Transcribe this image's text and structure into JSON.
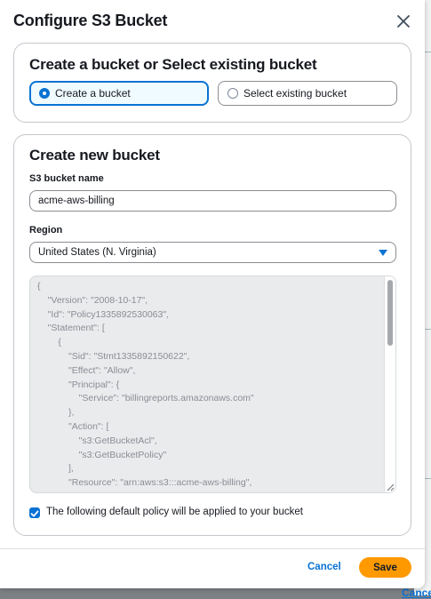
{
  "modal": {
    "title": "Configure S3 Bucket",
    "close_icon": "close-icon"
  },
  "bucket_choice": {
    "heading": "Create a bucket or Select existing bucket",
    "options": [
      {
        "label": "Create a bucket",
        "selected": true
      },
      {
        "label": "Select existing bucket",
        "selected": false
      }
    ]
  },
  "create_bucket": {
    "heading": "Create new bucket",
    "name_label": "S3 bucket name",
    "name_value": "acme-aws-billing",
    "region_label": "Region",
    "region_value": "United States (N. Virginia)",
    "region_icon": "caret-down-icon",
    "policy_text": "{\n    \"Version\": \"2008-10-17\",\n    \"Id\": \"Policy1335892530063\",\n    \"Statement\": [\n        {\n            \"Sid\": \"Stmt1335892150622\",\n            \"Effect\": \"Allow\",\n            \"Principal\": {\n                \"Service\": \"billingreports.amazonaws.com\"\n            },\n            \"Action\": [\n                \"s3:GetBucketAcl\",\n                \"s3:GetBucketPolicy\"\n            ],\n            \"Resource\": \"arn:aws:s3:::acme-aws-billing\",",
    "policy_checkbox_checked": true,
    "policy_checkbox_label": "The following default policy will be applied to your bucket"
  },
  "footer": {
    "cancel_label": "Cancel",
    "save_label": "Save"
  },
  "backdrop": {
    "cancel_label": "Cancel"
  },
  "colors": {
    "accent": "#0972d3",
    "primary_button": "#ff9900",
    "backdrop": "#7d8186"
  }
}
